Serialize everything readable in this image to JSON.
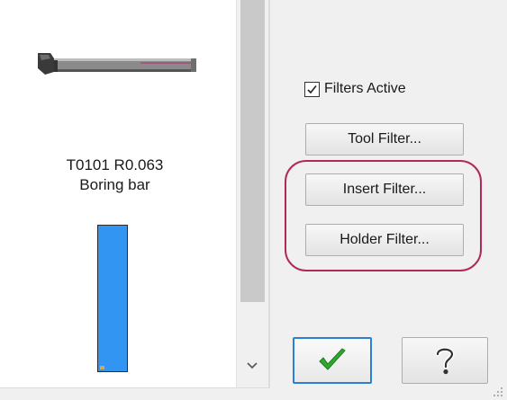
{
  "tool": {
    "name_line1": "T0101 R0.063",
    "name_line2": "Boring bar",
    "preview_icon": "boring-bar-icon",
    "bar_color": "#3395f2"
  },
  "filters": {
    "active_label": "Filters Active",
    "active_checked": true,
    "tool_filter_label": "Tool Filter...",
    "insert_filter_label": "Insert Filter...",
    "holder_filter_label": "Holder Filter..."
  },
  "actions": {
    "ok_icon": "checkmark-icon",
    "help_icon": "question-mark-icon"
  },
  "colors": {
    "highlight": "#b02a55",
    "ok_check": "#2ea82e",
    "focus_border": "#2d7fd3"
  }
}
